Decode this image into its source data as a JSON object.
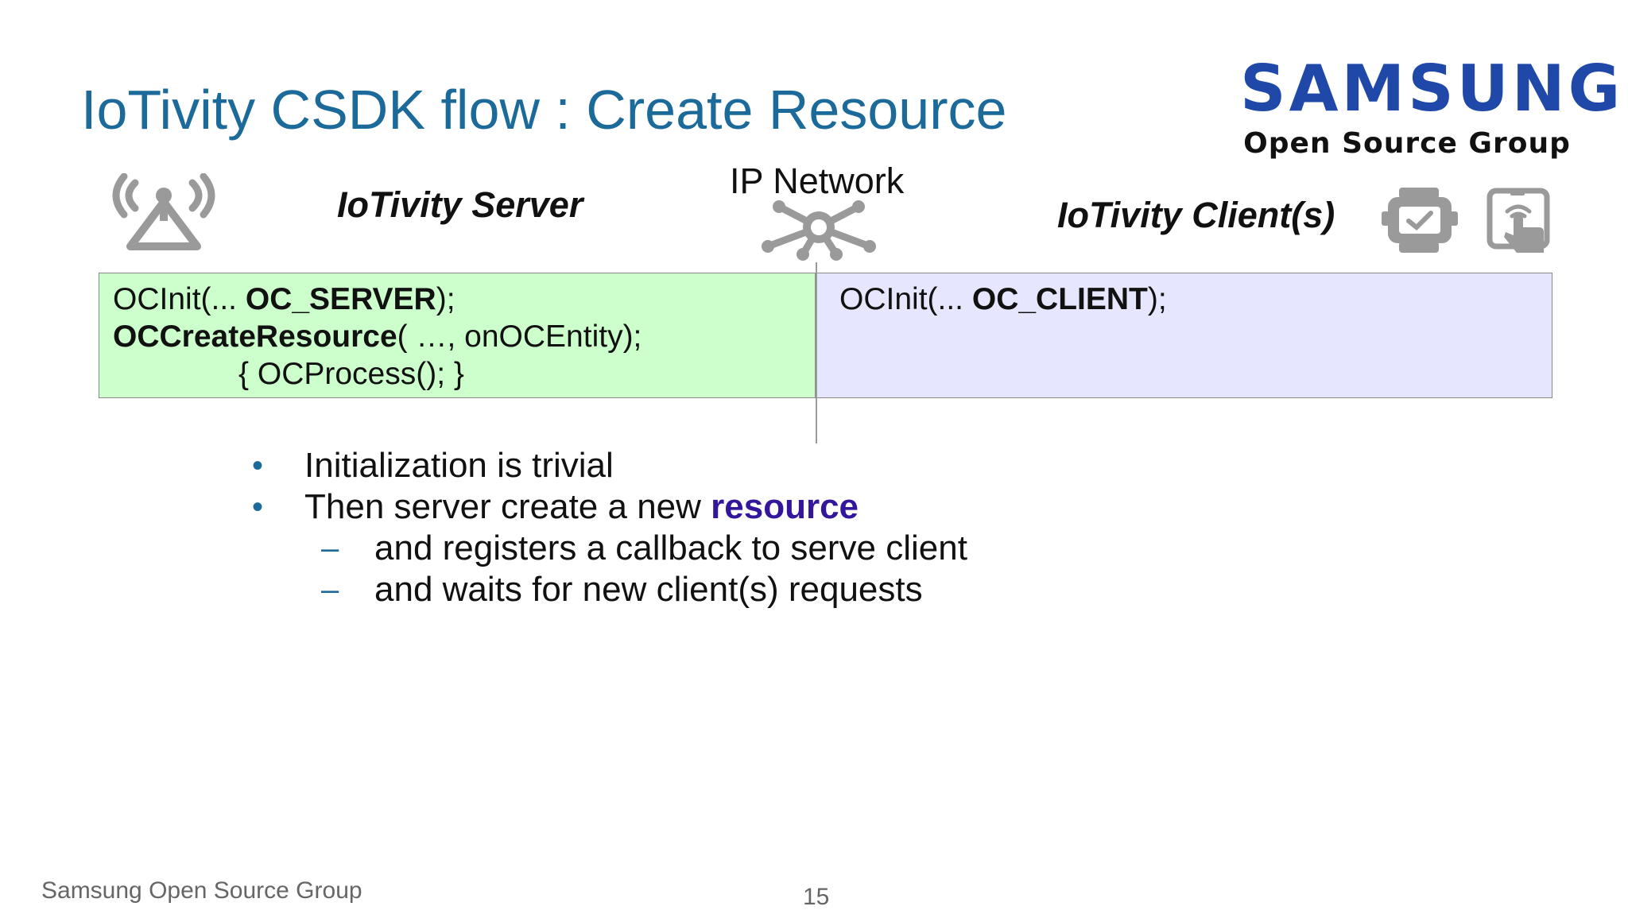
{
  "slide": {
    "title": "IoTivity CSDK flow : Create Resource",
    "logo": {
      "wordmark": "SAMSUNG",
      "subtitle": "Open Source Group",
      "color": "#1f48a8"
    },
    "server_label": "IoTivity Server",
    "client_label": "IoTivity Client(s)",
    "network_label": "IP Network",
    "icons": [
      "antenna-icon",
      "network-hub-icon",
      "smartwatch-icon",
      "tablet-touch-icon"
    ],
    "server_code": {
      "line1_prefix": "OCInit(... ",
      "line1_bold": "OC_SERVER",
      "line1_suffix": ");",
      "line2_bold": "OCCreateResource",
      "line2_suffix": "( …, onOCEntity);",
      "line3": "{  OCProcess();  }"
    },
    "client_code": {
      "line1_prefix": "OCInit(... ",
      "line1_bold": "OC_CLIENT",
      "line1_suffix": ");"
    },
    "bullets": [
      {
        "marker": "•",
        "text": "Initialization is trivial"
      },
      {
        "marker": "•",
        "text_prefix": "Then server create a new ",
        "highlight": "resource"
      }
    ],
    "sub_bullets": [
      {
        "marker": "–",
        "text": "and registers a callback to serve client"
      },
      {
        "marker": "–",
        "text": "and waits for new client(s) requests"
      }
    ],
    "colors": {
      "title": "#1b6a9a",
      "server_box": "#ccffcc",
      "client_box": "#e6e6ff",
      "highlight": "#33169c",
      "icon_gray": "#9a9a9a"
    },
    "footer": "Samsung Open Source Group",
    "page_number": "15"
  }
}
